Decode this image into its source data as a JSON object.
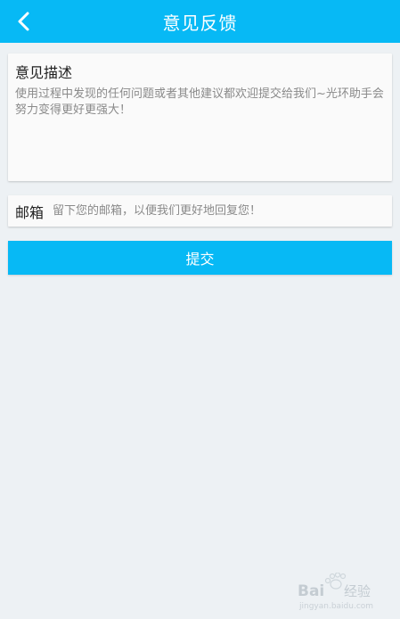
{
  "header": {
    "title": "意见反馈",
    "back_icon": "chevron-left-icon",
    "bg_color": "#07b9f5"
  },
  "feedback": {
    "label": "意见描述",
    "placeholder": "使用过程中发现的任何问题或者其他建议都欢迎提交给我们~光环助手会努力变得更好更强大！"
  },
  "email": {
    "label": "邮箱",
    "placeholder": "留下您的邮箱，以便我们更好地回复您！",
    "value": ""
  },
  "submit": {
    "label": "提交"
  },
  "watermark": {
    "brand_left": "Bai",
    "brand_right": "经验",
    "url": "jingyan.baidu.com"
  }
}
